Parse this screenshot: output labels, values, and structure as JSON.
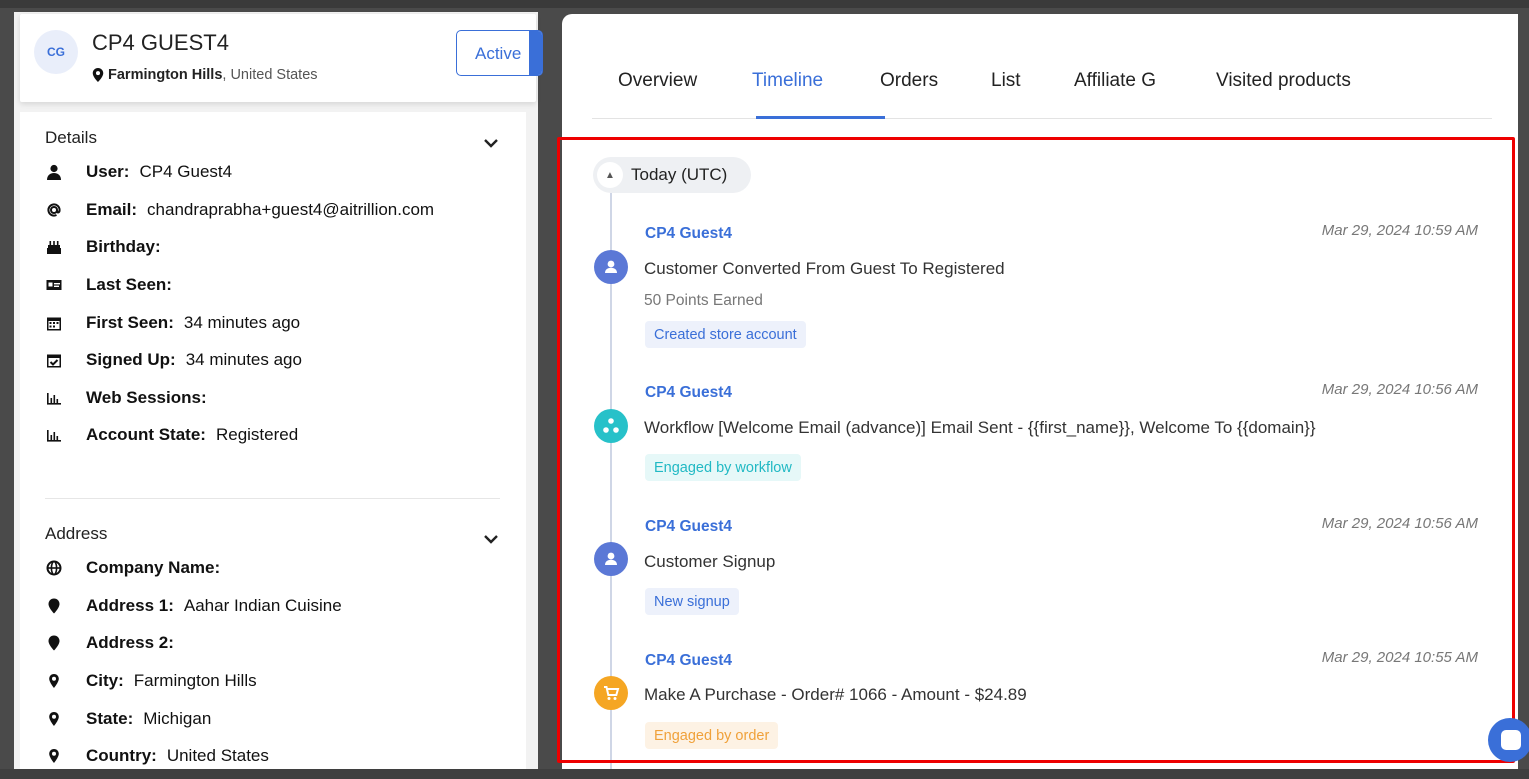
{
  "profile": {
    "initials": "CG",
    "name": "CP4 GUEST4",
    "city": "Farmington Hills",
    "country": ", United States",
    "status_button": "Active"
  },
  "details": {
    "title": "Details",
    "rows": [
      {
        "icon": "user-icon",
        "label": "User:",
        "value": "CP4 Guest4"
      },
      {
        "icon": "at-icon",
        "label": "Email:",
        "value": "chandraprabha+guest4@aitrillion.com"
      },
      {
        "icon": "cake-icon",
        "label": "Birthday:",
        "value": ""
      },
      {
        "icon": "id-card-icon",
        "label": "Last Seen:",
        "value": ""
      },
      {
        "icon": "calendar-icon",
        "label": "First Seen:",
        "value": "34 minutes ago"
      },
      {
        "icon": "calendar-check-icon",
        "label": "Signed Up:",
        "value": "34 minutes ago"
      },
      {
        "icon": "chart-icon",
        "label": "Web Sessions:",
        "value": ""
      },
      {
        "icon": "chart-icon",
        "label": "Account State:",
        "value": "Registered"
      }
    ]
  },
  "address": {
    "title": "Address",
    "rows": [
      {
        "icon": "globe-icon",
        "label": "Company Name:",
        "value": ""
      },
      {
        "icon": "map-marker-icon",
        "label": "Address 1:",
        "value": "Aahar Indian Cuisine"
      },
      {
        "icon": "map-marker-icon",
        "label": "Address 2:",
        "value": ""
      },
      {
        "icon": "pin-icon",
        "label": "City:",
        "value": "Farmington Hills"
      },
      {
        "icon": "pin-icon",
        "label": "State:",
        "value": "Michigan"
      },
      {
        "icon": "pin-icon",
        "label": "Country:",
        "value": "United States"
      }
    ]
  },
  "tabs": [
    "Overview",
    "Timeline",
    "Orders",
    "List",
    "Affiliate G",
    "Visited products"
  ],
  "active_tab": "Timeline",
  "timeline": {
    "day_label": "Today (UTC)",
    "events": [
      {
        "who": "CP4 Guest4",
        "when": "Mar 29, 2024 10:59 AM",
        "desc": "Customer Converted From Guest To Registered",
        "sub": "50 Points Earned",
        "tag": "Created store account",
        "icon": "user-circle-icon",
        "color": "#5b78d6",
        "tag_style": "blue"
      },
      {
        "who": "CP4 Guest4",
        "when": "Mar 29, 2024 10:56 AM",
        "desc": "Workflow [Welcome Email (advance)] Email Sent - {{first_name}}, Welcome To {{domain}}",
        "sub": "",
        "tag": "Engaged by workflow",
        "icon": "workflow-icon",
        "color": "#27c1c9",
        "tag_style": "teal"
      },
      {
        "who": "CP4 Guest4",
        "when": "Mar 29, 2024 10:56 AM",
        "desc": "Customer Signup",
        "sub": "",
        "tag": "New signup",
        "icon": "user-circle-icon",
        "color": "#5b78d6",
        "tag_style": "blue"
      },
      {
        "who": "CP4 Guest4",
        "when": "Mar 29, 2024 10:55 AM",
        "desc": "Make A Purchase - Order# 1066 - Amount - $24.89",
        "sub": "",
        "tag": "Engaged by order",
        "icon": "cart-icon",
        "color": "#f5a623",
        "tag_style": "orange"
      }
    ]
  }
}
